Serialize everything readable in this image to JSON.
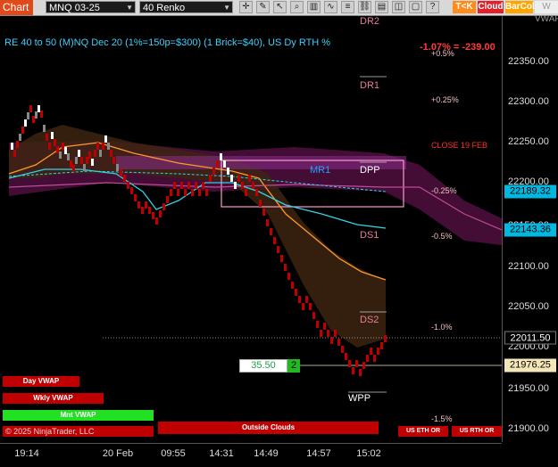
{
  "toolbar": {
    "chart_label": "Chart",
    "symbol": "MNQ 03-25",
    "bar_type": "40 Renko",
    "buttons": [
      "T<K",
      "Cloud",
      "BarCol",
      "W VWAP"
    ],
    "icons": [
      "crosshair-icon",
      "drawing-icon",
      "pointer-icon",
      "zoom-icon",
      "chart-type-icon",
      "indicators-icon",
      "properties-icon",
      "link-icon",
      "template-icon",
      "screenshot-icon",
      "window-icon",
      "help-icon"
    ]
  },
  "chart_header": {
    "title": "RE 40 to 50 (M)NQ Dec 20 (1%=150p=$300) (1 Brick=$40), US Dy RTH %",
    "pct_change": "-1.07% = -239.00"
  },
  "levels": [
    {
      "text": "DR2",
      "color": "#e87d9a",
      "underline": false
    },
    {
      "text": "+0.5%",
      "color": "#f0c0c0",
      "underline": false
    },
    {
      "text": "DR1",
      "color": "#e87d9a",
      "underline": true
    },
    {
      "text": "+0.25%",
      "color": "#f0c0c0",
      "underline": false
    },
    {
      "text": "CLOSE 19 FEB",
      "color": "#ff3030",
      "underline": false
    },
    {
      "text": "MR1",
      "color": "#2aa0ff",
      "underline": false
    },
    {
      "text": "DPP",
      "color": "#ffffff",
      "underline": true
    },
    {
      "text": "-0.25%",
      "color": "#f0c0c0",
      "underline": false
    },
    {
      "text": "DS1",
      "color": "#e87d9a",
      "underline": false
    },
    {
      "text": "-0.5%",
      "color": "#f0c0c0",
      "underline": false
    },
    {
      "text": "DS2",
      "color": "#e87d9a",
      "underline": true
    },
    {
      "text": "-1.0%",
      "color": "#f0c0c0",
      "underline": false
    },
    {
      "text": "WPP",
      "color": "#ffffff",
      "underline": true
    },
    {
      "text": "-1.5%",
      "color": "#f0c0c0",
      "underline": false
    }
  ],
  "price_axis": {
    "ticks": [
      "22350.00",
      "22300.00",
      "22250.00",
      "22200.00",
      "22150.00",
      "22100.00",
      "22050.00",
      "22000.00",
      "21950.00",
      "21900.00"
    ],
    "badges": [
      {
        "text": "22189.32",
        "bg": "#00b8e0",
        "fg": "#000000"
      },
      {
        "text": "22143.36",
        "bg": "#00b8e0",
        "fg": "#000000"
      },
      {
        "text": "22011.50",
        "bg": "#000000",
        "fg": "#ffffff"
      },
      {
        "text": "21976.25",
        "bg": "#f5e6b8",
        "fg": "#000000"
      }
    ]
  },
  "time_axis": {
    "ticks": [
      "19:14",
      "20 Feb",
      "09:55",
      "14:31",
      "14:49",
      "14:57",
      "15:02"
    ]
  },
  "order_box": {
    "value": "35.50",
    "qty": "2"
  },
  "panel_buttons": {
    "day_vwap": "Day VWAP",
    "wkly_vwap": "Wkly VWAP",
    "mnt_vwap": "Mnt VWAP",
    "outside_clouds": "Outside Clouds",
    "us_eth_or": "US ETH OR",
    "us_rth_or": "US RTH OR"
  },
  "copyright": "© 2025 NinjaTrader, LLC"
}
